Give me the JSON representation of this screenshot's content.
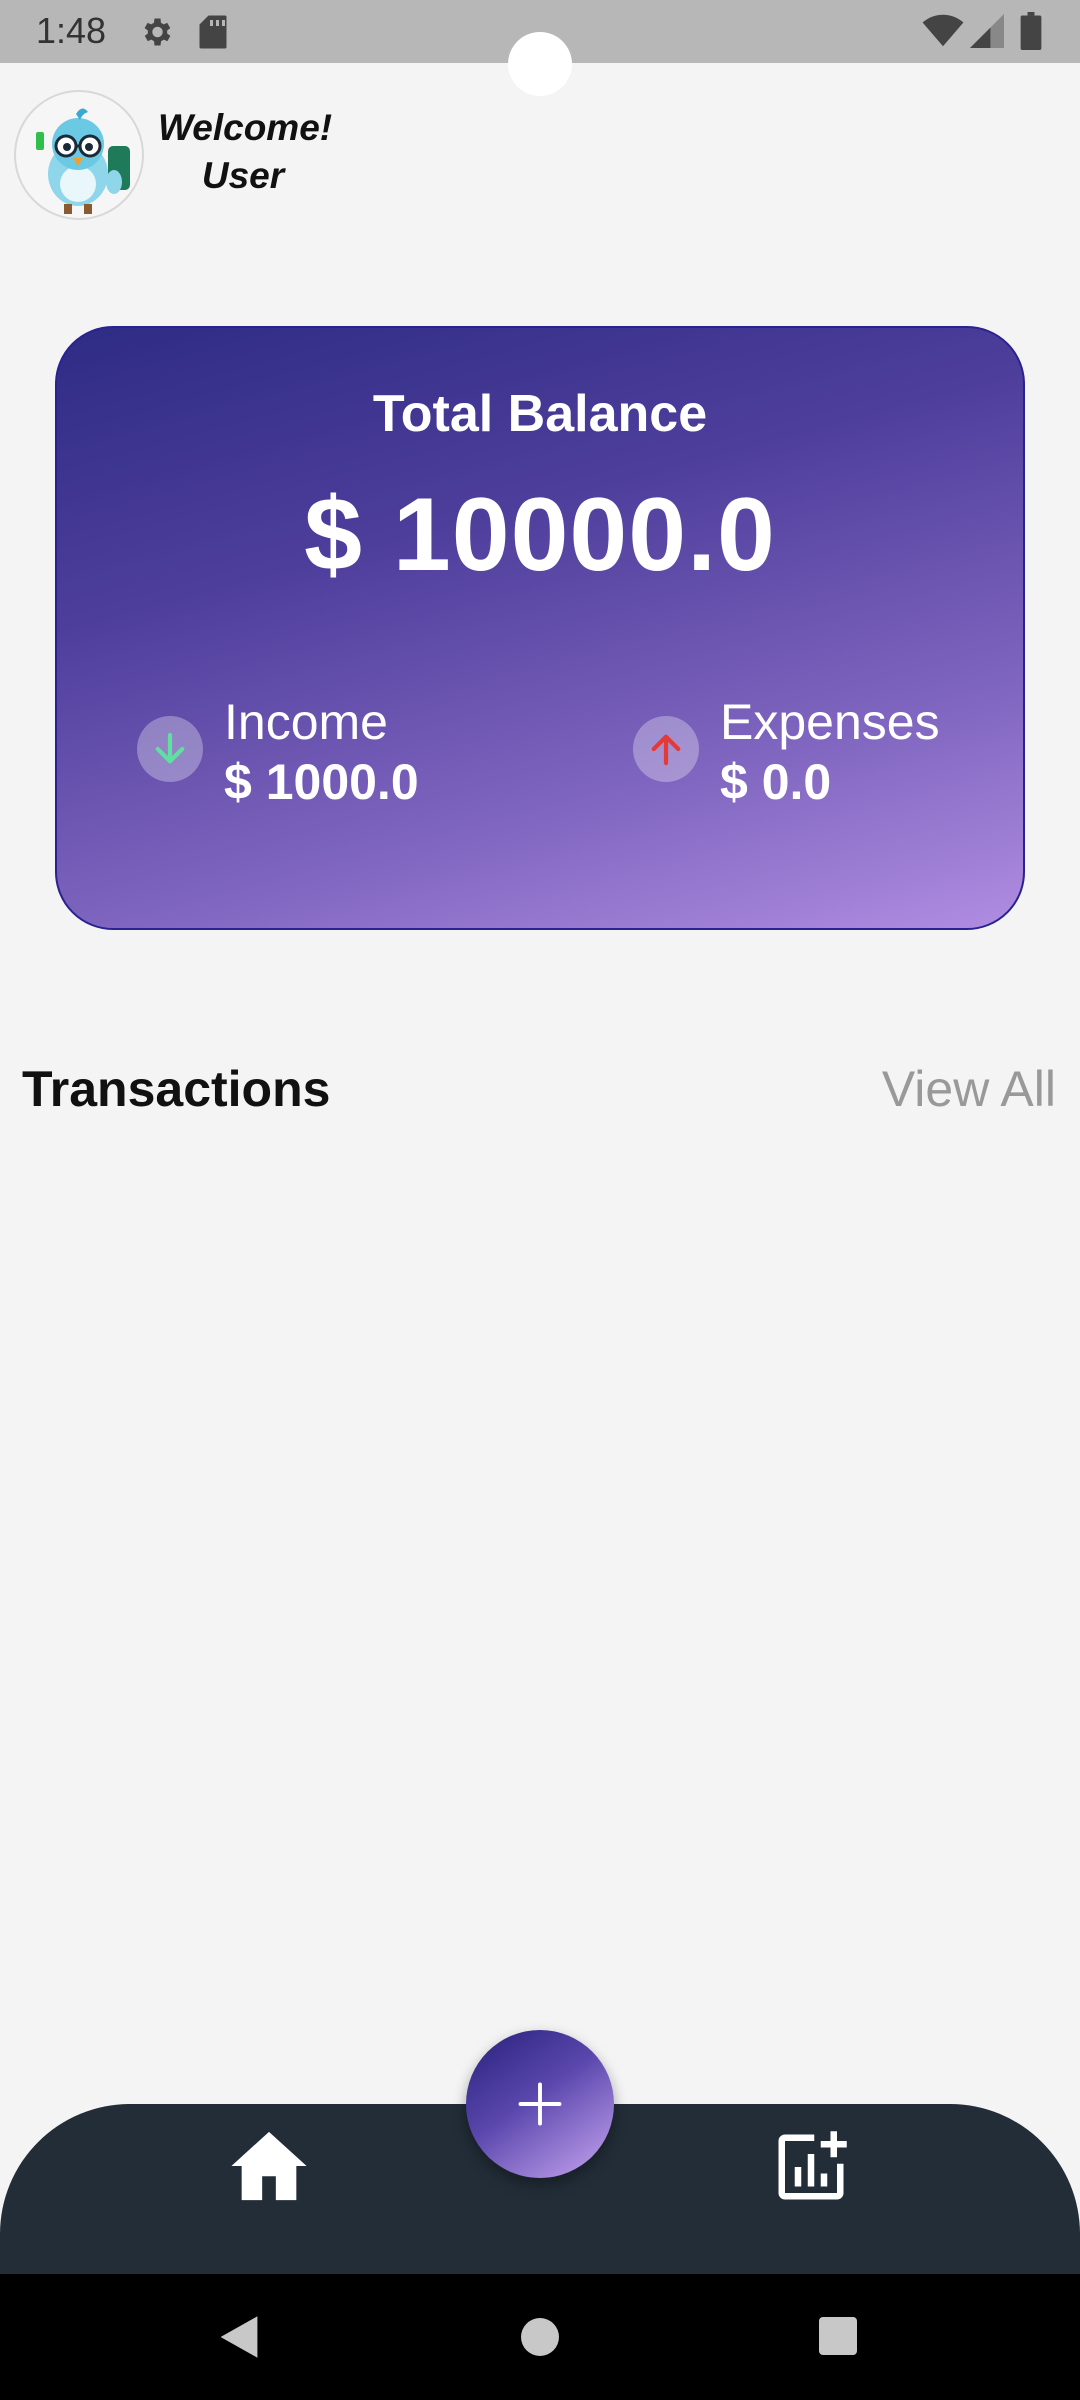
{
  "status_bar": {
    "time": "1:48",
    "icons": [
      "gear-icon",
      "sd-card-icon",
      "wifi-icon",
      "signal-icon",
      "battery-icon"
    ]
  },
  "header": {
    "welcome_line1": "Welcome!",
    "welcome_line2": "User",
    "avatar": "bird-mascot-avatar"
  },
  "balance_card": {
    "title": "Total Balance",
    "amount": "$ 10000.0",
    "income": {
      "label": "Income",
      "value": "$ 1000.0",
      "icon": "arrow-down-icon",
      "icon_color": "#5fe0a0"
    },
    "expenses": {
      "label": "Expenses",
      "value": "$ 0.0",
      "icon": "arrow-up-icon",
      "icon_color": "#e53935"
    }
  },
  "transactions": {
    "title": "Transactions",
    "view_all": "View All",
    "items": []
  },
  "bottom_nav": {
    "items": [
      "home-icon",
      "add-chart-icon"
    ],
    "fab": "plus-icon"
  },
  "colors": {
    "background": "#f4f4f4",
    "card_gradient_start": "#2e2c85",
    "card_gradient_end": "#b08de2",
    "nav_bar": "#222d38",
    "muted_text": "#999999"
  }
}
